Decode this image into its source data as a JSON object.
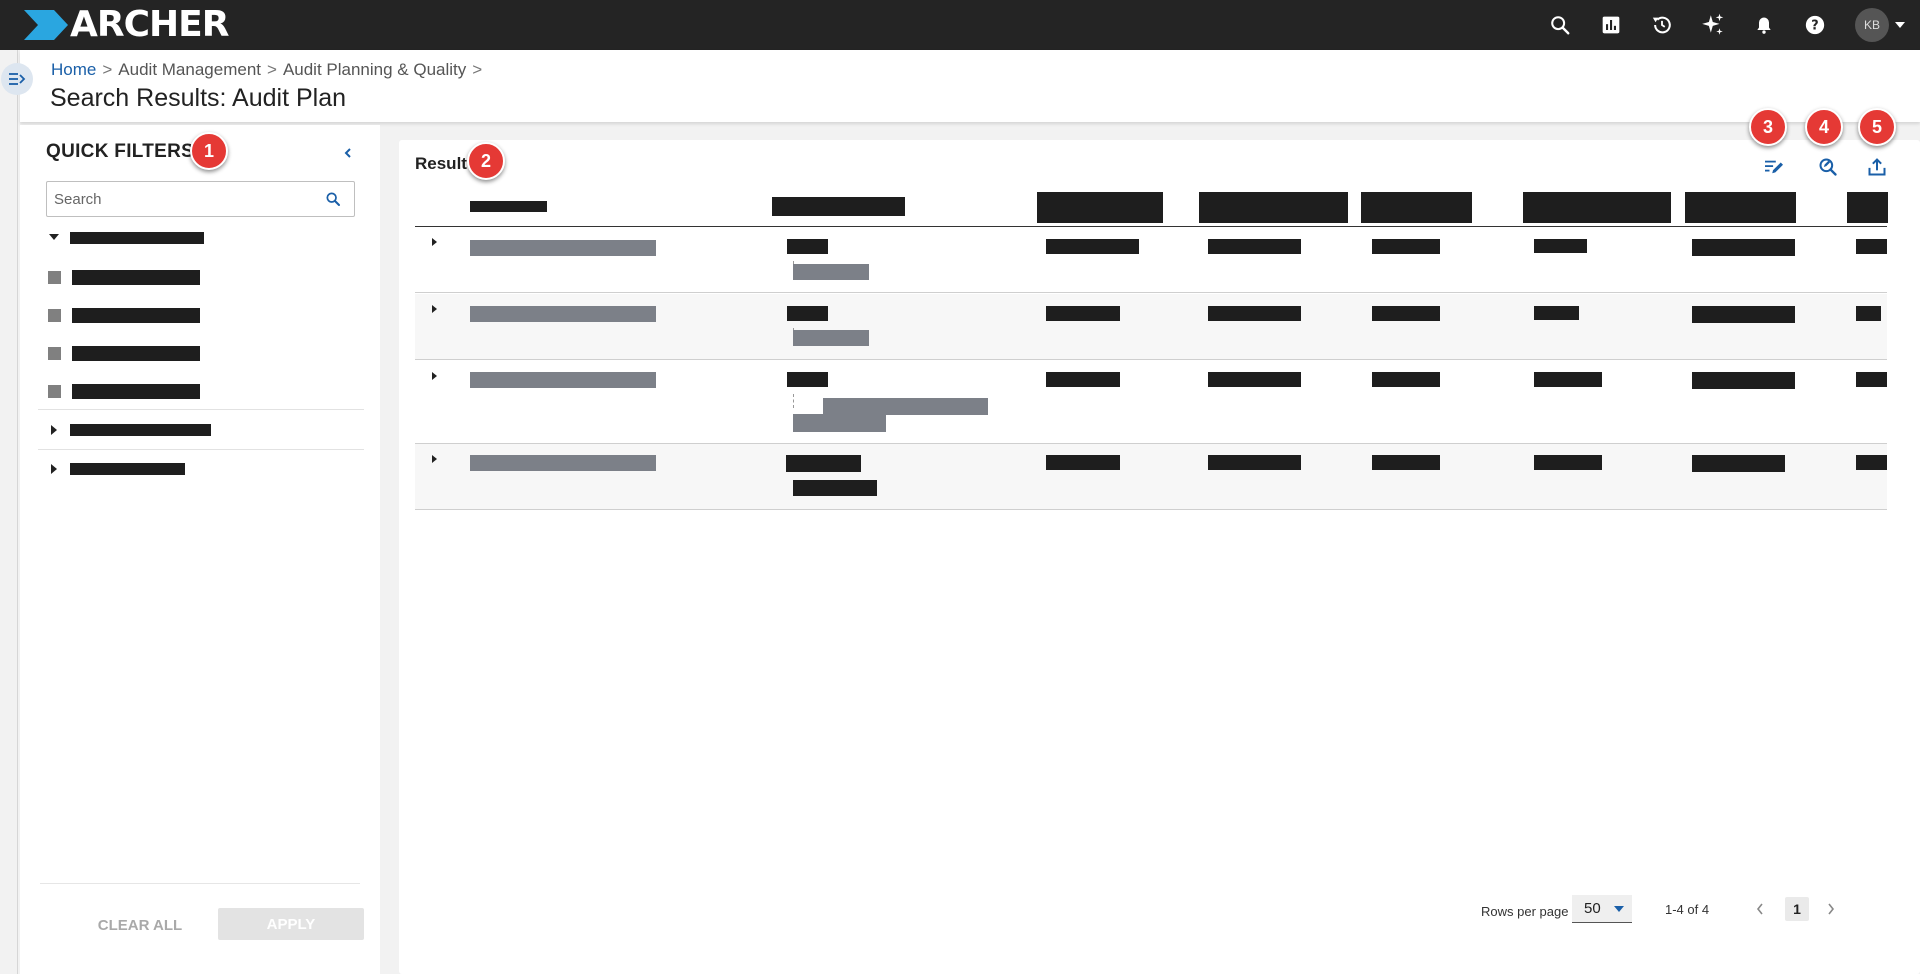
{
  "app": {
    "logo_text": "ARCHER",
    "user_initials": "KB"
  },
  "topbar": {
    "icons": [
      "search-icon",
      "reports-icon",
      "history-icon",
      "ai-sparkle-icon",
      "notifications-icon",
      "help-icon"
    ]
  },
  "breadcrumb": {
    "home": "Home",
    "items": [
      "Audit Management",
      "Audit Planning & Quality"
    ],
    "separator": ">"
  },
  "page": {
    "title": "Search Results: Audit Plan"
  },
  "quick_filters": {
    "title": "QUICK FILTERS",
    "search_placeholder": "Search",
    "clear_label": "CLEAR ALL",
    "apply_label": "APPLY"
  },
  "result": {
    "title": "Result",
    "row_count": 4
  },
  "pagination": {
    "rows_per_page_label": "Rows per page",
    "rows_per_page": "50",
    "range": "1-4 of 4",
    "current_page": "1"
  },
  "annotations": [
    "1",
    "2",
    "3",
    "4",
    "5"
  ],
  "colors": {
    "topbar": "#242424",
    "accent": "#1a5fa8",
    "badge": "#e53935",
    "redaction": "#1e1e1e",
    "redaction_link": "#7c8088"
  }
}
